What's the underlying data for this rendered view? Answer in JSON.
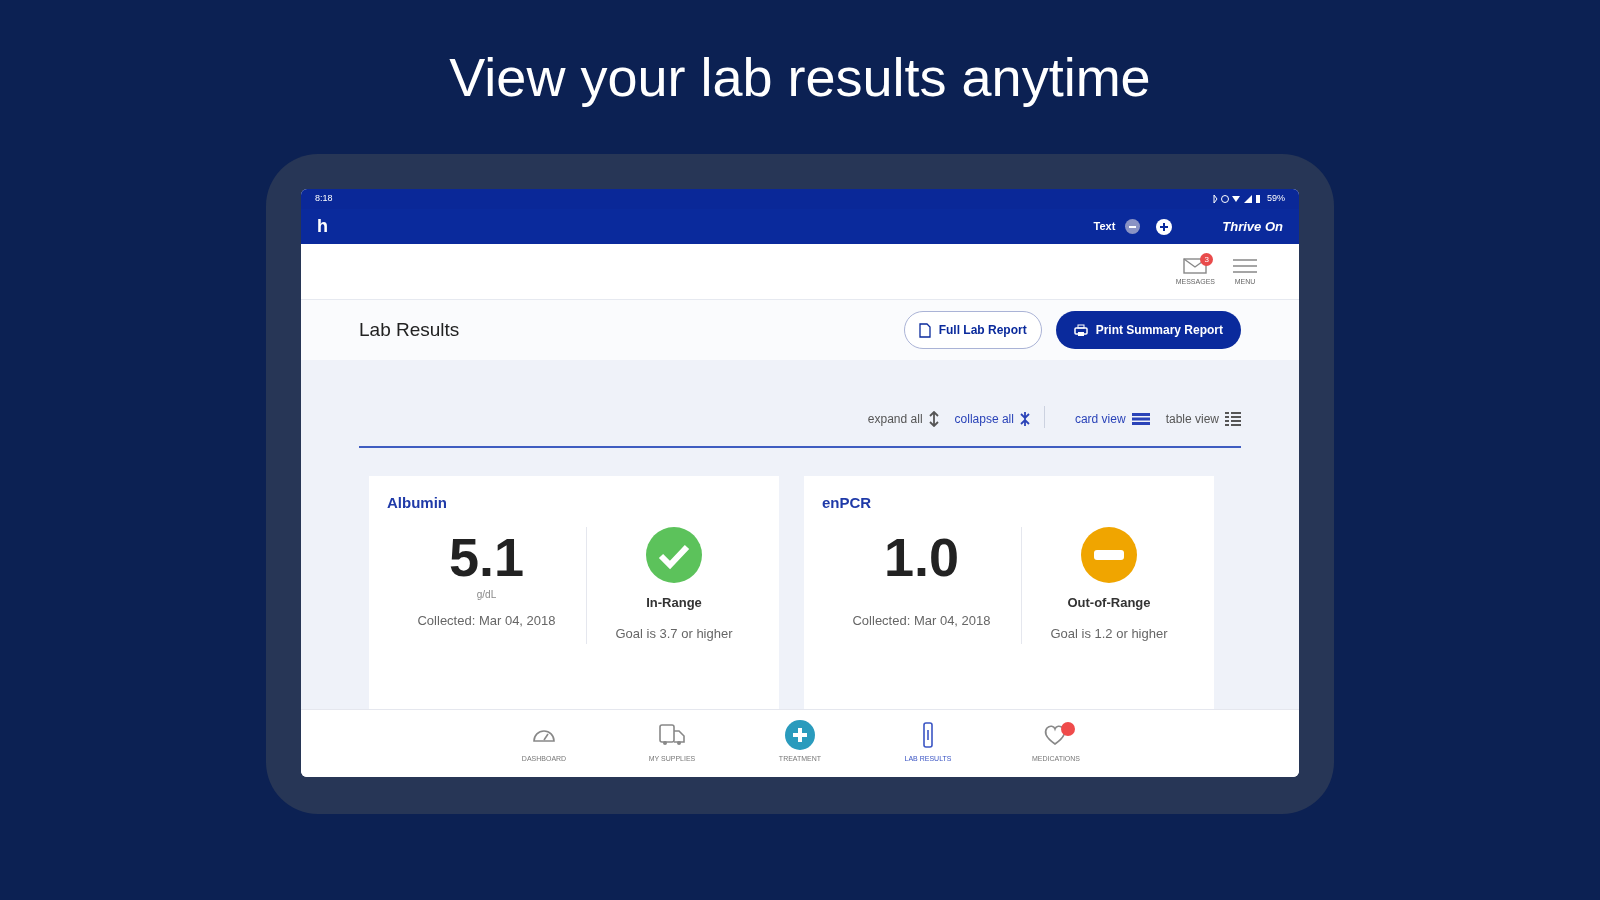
{
  "headline": "View your lab results anytime",
  "status_bar": {
    "time": "8:18",
    "battery": "59%"
  },
  "app_bar": {
    "logo": "h",
    "text_size_label": "Text",
    "brand": "Thrive On"
  },
  "header_actions": [
    {
      "label": "MESSAGES",
      "kind": "mail",
      "badge": "3"
    },
    {
      "label": "MENU",
      "kind": "menu"
    }
  ],
  "page": {
    "title": "Lab Results",
    "buttons": [
      {
        "label": "Full Lab Report",
        "kind": "outline"
      },
      {
        "label": "Print Summary Report",
        "kind": "primary"
      }
    ]
  },
  "toolbar": [
    {
      "label": "expand all",
      "kind": "expand",
      "selected": false
    },
    {
      "label": "collapse all",
      "kind": "collapse",
      "selected": true
    },
    {
      "label": "card view",
      "kind": "cards",
      "selected": true
    },
    {
      "label": "table view",
      "kind": "table",
      "selected": false
    }
  ],
  "cards": [
    {
      "name": "Albumin",
      "value": "5.1",
      "unit": "g/dL",
      "collected": "Collected: Mar 04, 2018",
      "kind": "in_range",
      "status": "In-Range",
      "goal": "Goal is 3.7 or higher"
    },
    {
      "name": "enPCR",
      "value": "1.0",
      "collected": "Collected: Mar 04, 2018",
      "kind": "out_of_range",
      "status": "Out-of-Range",
      "goal": "Goal is 1.2 or higher"
    }
  ],
  "bottom_nav": [
    {
      "label": "DASHBOARD",
      "kind": "gauge",
      "selected": false,
      "has_badge": false
    },
    {
      "label": "MY SUPPLIES",
      "kind": "truck",
      "selected": false,
      "has_badge": false
    },
    {
      "label": "TREATMENT",
      "kind": "plus",
      "selected": false,
      "has_badge": false
    },
    {
      "label": "LAB RESULTS",
      "kind": "tube",
      "selected": true,
      "has_badge": false
    },
    {
      "label": "MEDICATIONS",
      "kind": "heart",
      "selected": false,
      "has_badge": true
    }
  ]
}
